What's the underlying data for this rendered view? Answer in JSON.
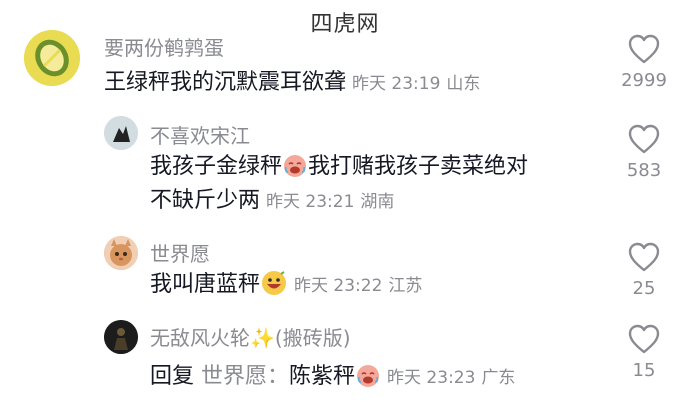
{
  "watermark": "四虎网",
  "comments": [
    {
      "username": "要两份鹌鹑蛋",
      "lines": [
        "王绿秤我的沉默震耳欲聋"
      ],
      "time": "昨天 23:19",
      "location": "山东",
      "likes": "2999",
      "avatar_icon": "lemon-avatar-icon"
    },
    {
      "username": "不喜欢宋江",
      "lines": [
        "我孩子金绿秤",
        "我打赌我孩子卖菜绝对",
        "不缺斤少两"
      ],
      "time": "昨天 23:21",
      "location": "湖南",
      "likes": "583",
      "emoji": "laughing-cry-emoji",
      "avatar_icon": "silhouette-avatar-icon"
    },
    {
      "username": "世界愿",
      "lines": [
        "我叫唐蓝秤"
      ],
      "time": "昨天 23:22",
      "location": "江苏",
      "likes": "25",
      "emoji": "grinning-emoji",
      "avatar_icon": "cat-avatar-icon"
    },
    {
      "username": "无敌风火轮",
      "username_suffix": "(搬砖版)",
      "lines": [
        "回复 ",
        "世界愿：",
        "陈紫秤"
      ],
      "time": "昨天 23:23",
      "location": "广东",
      "likes": "15",
      "emoji": "laughing-cry-emoji",
      "avatar_icon": "dark-figure-avatar-icon"
    }
  ]
}
